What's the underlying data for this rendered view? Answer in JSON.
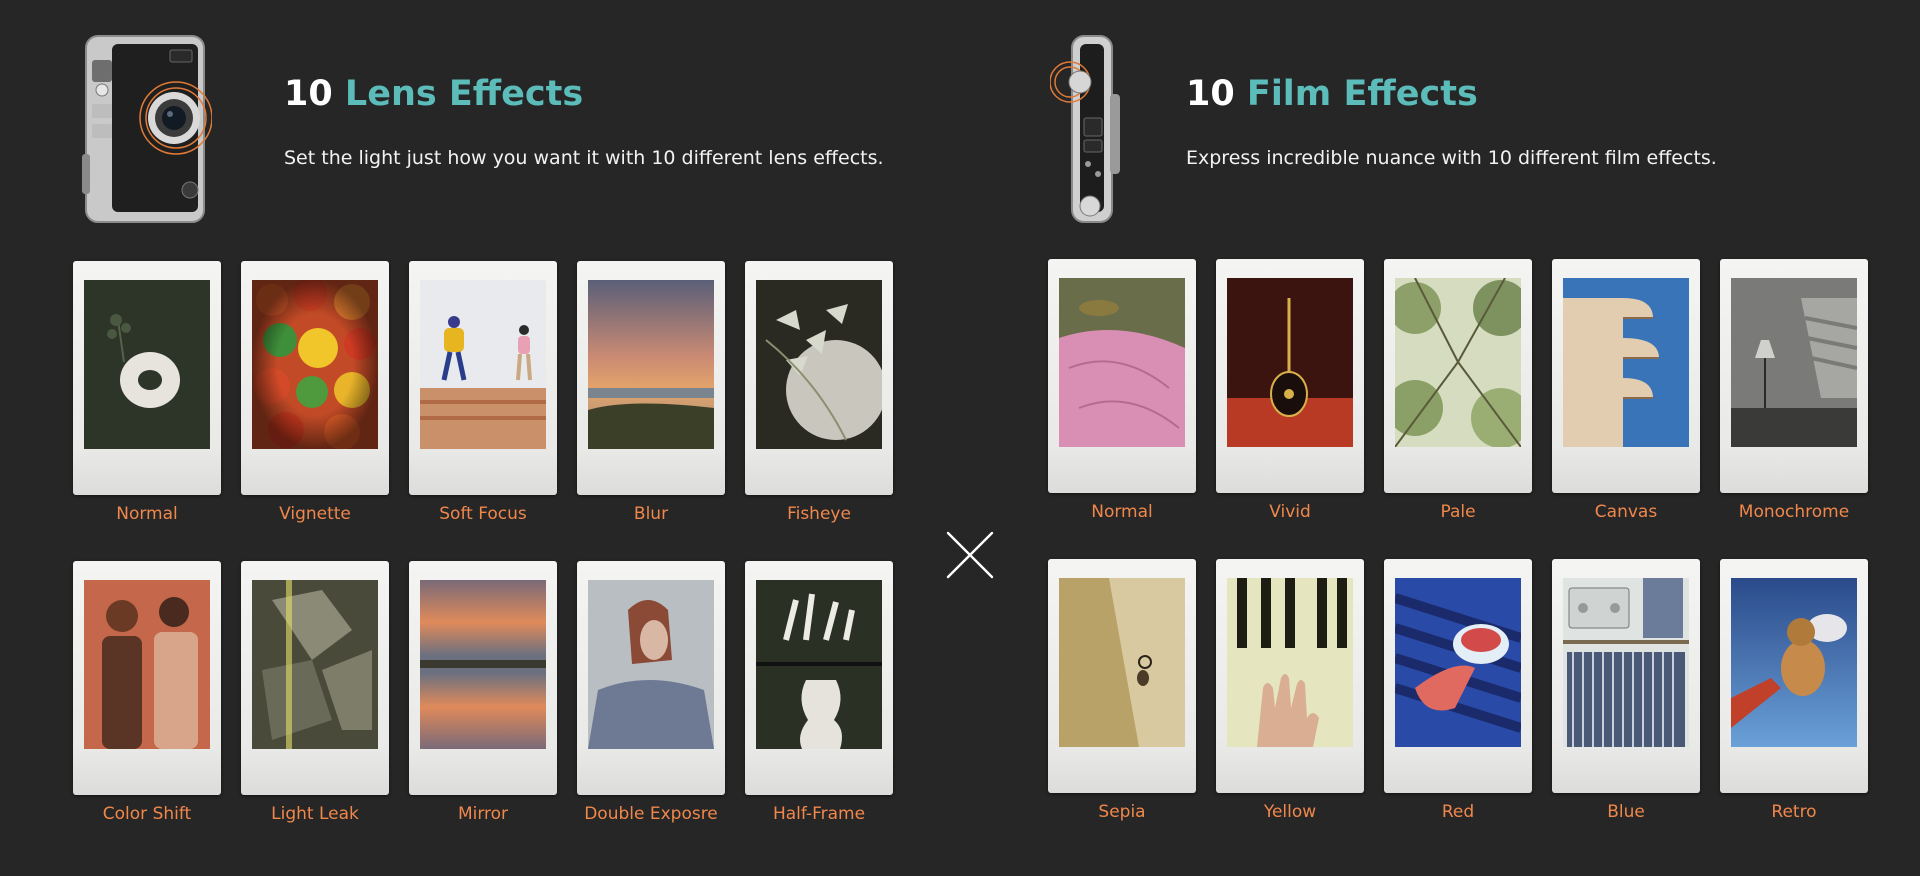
{
  "lens_section": {
    "title_number": "10",
    "title_text": "Lens Effects",
    "subtitle": "Set the light just how you want it with 10 different lens effects.",
    "effects": [
      "Normal",
      "Vignette",
      "Soft Focus",
      "Blur",
      "Fisheye",
      "Color Shift",
      "Light Leak",
      "Mirror",
      "Double Exposre",
      "Half-Frame"
    ]
  },
  "film_section": {
    "title_number": "10",
    "title_text": "Film Effects",
    "subtitle": "Express incredible nuance with 10 different film effects.",
    "effects": [
      "Normal",
      "Vivid",
      "Pale",
      "Canvas",
      "Monochrome",
      "Sepia",
      "Yellow",
      "Red",
      "Blue",
      "Retro"
    ]
  },
  "icons": {
    "lens_camera": "instax-camera-front-icon",
    "film_camera": "instax-camera-side-icon",
    "divider": "close-x-icon"
  },
  "colors": {
    "background": "#262626",
    "accent": "#5bbcba",
    "label": "#f0874b"
  }
}
